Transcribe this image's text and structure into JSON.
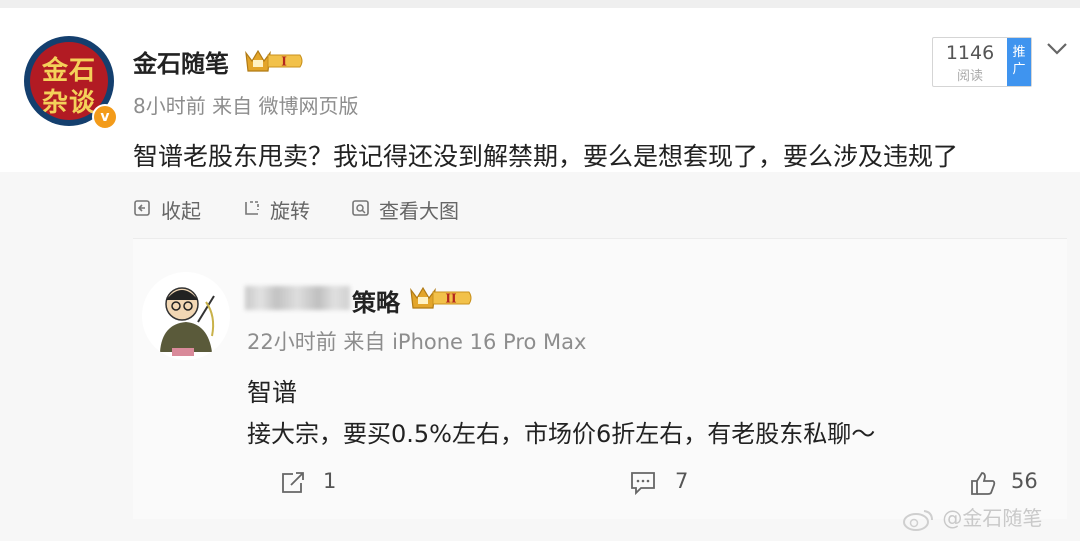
{
  "post": {
    "username": "金石随笔",
    "avatar_text_line1": "金石",
    "avatar_text_line2": "杂谈",
    "verified_badge": "v",
    "crown_level": "I",
    "meta": "8小时前 来自 微博网页版",
    "text": "智谱老股东甩卖？我记得还没到解禁期，要么是想套现了，要么涉及违规了",
    "reads_count": "1146",
    "reads_label": "阅读",
    "promo_label_1": "推",
    "promo_label_2": "广"
  },
  "media_toolbar": {
    "collapse_label": "收起",
    "rotate_label": "旋转",
    "view_large_label": "查看大图"
  },
  "repost": {
    "username_visible": "策略",
    "crown_level": "II",
    "meta": "22小时前 来自 iPhone 16 Pro Max",
    "text_line1": "智谱",
    "text_line2": "接大宗，要买0.5%左右，市场价6折左右，有老股东私聊～",
    "share_count": "1",
    "comment_count": "7",
    "like_count": "56"
  },
  "watermark": "@金石随笔",
  "colors": {
    "promo_blue": "#3f94ef",
    "crown_gold": "#e3a52a",
    "verified_orange": "#f39b1a",
    "avatar_red": "#b21b23",
    "avatar_navy": "#143f6e"
  },
  "icons": [
    "chevron-down-icon",
    "collapse-icon",
    "rotate-icon",
    "view-large-icon",
    "share-icon",
    "comment-icon",
    "like-icon",
    "weibo-logo-icon",
    "crown-icon"
  ]
}
